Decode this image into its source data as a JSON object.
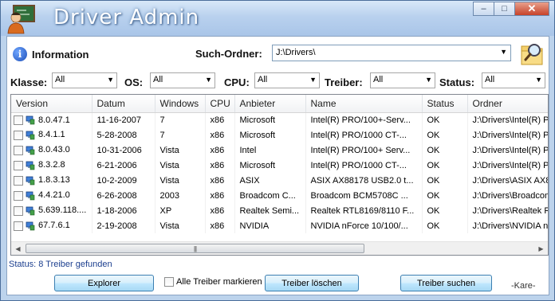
{
  "window": {
    "title": "Driver Admin"
  },
  "info": {
    "label": "Information"
  },
  "search": {
    "label": "Such-Ordner:",
    "value": "J:\\Drivers\\"
  },
  "filters": [
    {
      "label": "Klasse:",
      "value": "All"
    },
    {
      "label": "OS:",
      "value": "All"
    },
    {
      "label": "CPU:",
      "value": "All"
    },
    {
      "label": "Treiber:",
      "value": "All"
    },
    {
      "label": "Status:",
      "value": "All"
    }
  ],
  "table": {
    "columns": [
      "Version",
      "Datum",
      "Windows",
      "CPU",
      "Anbieter",
      "Name",
      "Status",
      "Ordner"
    ],
    "rows": [
      [
        "8.0.47.1",
        "11-16-2007",
        "7",
        "x86",
        "Microsoft",
        "Intel(R) PRO/100+-Serv...",
        "OK",
        "J:\\Drivers\\Intel(R) P"
      ],
      [
        "8.4.1.1",
        "5-28-2008",
        "7",
        "x86",
        "Microsoft",
        "Intel(R) PRO/1000 CT-...",
        "OK",
        "J:\\Drivers\\Intel(R) P"
      ],
      [
        "8.0.43.0",
        "10-31-2006",
        "Vista",
        "x86",
        "Intel",
        "Intel(R) PRO/100+ Serv...",
        "OK",
        "J:\\Drivers\\Intel(R) P"
      ],
      [
        "8.3.2.8",
        "6-21-2006",
        "Vista",
        "x86",
        "Microsoft",
        "Intel(R) PRO/1000 CT-...",
        "OK",
        "J:\\Drivers\\Intel(R) P"
      ],
      [
        "1.8.3.13",
        "10-2-2009",
        "Vista",
        "x86",
        "ASIX",
        "ASIX AX88178 USB2.0 t...",
        "OK",
        "J:\\Drivers\\ASIX AX8"
      ],
      [
        "4.4.21.0",
        "6-26-2008",
        "2003",
        "x86",
        "Broadcom C...",
        "Broadcom BCM5708C ...",
        "OK",
        "J:\\Drivers\\Broadcom"
      ],
      [
        "5.639.118....",
        "1-18-2006",
        "XP",
        "x86",
        "Realtek Semi...",
        "Realtek RTL8169/8110 F...",
        "OK",
        "J:\\Drivers\\Realtek R"
      ],
      [
        "67.7.6.1",
        "2-19-2008",
        "Vista",
        "x86",
        "NVIDIA",
        "NVIDIA nForce 10/100/...",
        "OK",
        "J:\\Drivers\\NVIDIA n"
      ]
    ]
  },
  "status_text": "Status: 8 Treiber gefunden",
  "buttons": {
    "explorer": "Explorer",
    "mark_all": "Alle Treiber markieren",
    "delete": "Treiber löschen",
    "search": "Treiber suchen"
  },
  "signature": "-Kare-",
  "icons": {
    "app": "admin-person-icon",
    "info": "info-icon",
    "folder": "folder-search-icon",
    "device": "network-device-icon"
  },
  "colors": {
    "titlebar": "#b9d1ee",
    "status_text": "#1c3f8f",
    "button": "#bee6fd",
    "close": "#c7432a"
  }
}
